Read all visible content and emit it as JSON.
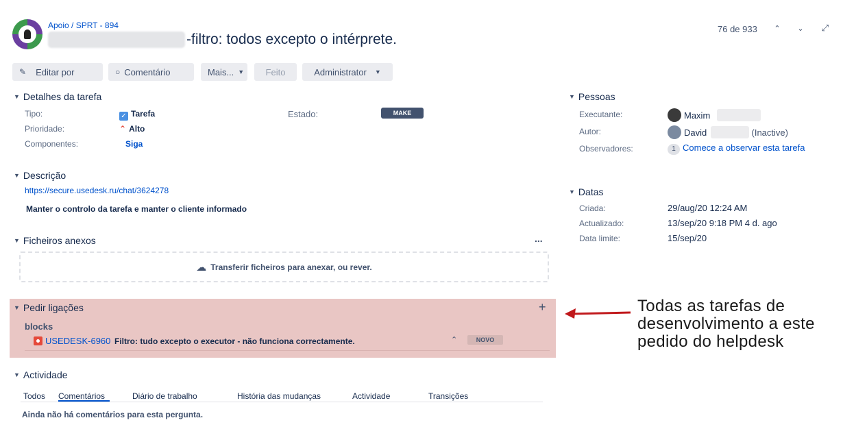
{
  "header": {
    "breadcrumb": "Apoio / SPRT - 894",
    "title": "-filtro: todos excepto o intérprete.",
    "counter": "76 de 933"
  },
  "toolbar": {
    "edit_label": "Editar por",
    "comment_label": "Comentário",
    "more_label": "Mais...",
    "done_label": "Feito",
    "admin_label": "Administrator"
  },
  "details": {
    "heading": "Detalhes da tarefa",
    "type_label": "Tipo:",
    "type_value": "Tarefa",
    "priority_label": "Prioridade:",
    "priority_value": "Alto",
    "components_label": "Componentes:",
    "components_value": "Siga",
    "status_label": "Estado:",
    "status_value": "MAKE"
  },
  "description": {
    "heading": "Descrição",
    "link": "https://secure.usedesk.ru/chat/3624278",
    "text": "Manter o controlo da tarefa e manter o cliente informado"
  },
  "attachments": {
    "heading": "Ficheiros anexos",
    "more": "...",
    "drop_text": "Transferir ficheiros para anexar, ou rever."
  },
  "links": {
    "heading": "Pedir ligações",
    "add": "+",
    "relation": "blocks",
    "issue_key": "USEDESK-6960",
    "issue_summary": "Filtro: tudo excepto o executor - não funciona correctamente.",
    "issue_status": "NOVO"
  },
  "activity": {
    "heading": "Actividade",
    "tabs": [
      "Todos",
      "Comentários",
      "Diário de trabalho",
      "História das mudanças",
      "Actividade",
      "Transições"
    ],
    "empty_text": "Ainda não há comentários para esta pergunta."
  },
  "people": {
    "heading": "Pessoas",
    "assignee_label": "Executante:",
    "assignee_value": "Maxim",
    "reporter_label": "Autor:",
    "reporter_value": "David",
    "reporter_suffix": "(Inactive)",
    "watchers_label": "Observadores:",
    "watchers_count": "1",
    "watchers_action": "Comece a observar esta tarefa"
  },
  "dates": {
    "heading": "Datas",
    "created_label": "Criada:",
    "created_value": "29/aug/20 12:24 AM",
    "updated_label": "Actualizado:",
    "updated_value": "13/sep/20 9:18 PM 4 d. ago",
    "due_label": "Data limite:",
    "due_value": "15/sep/20"
  },
  "annotation": {
    "text": "Todas as tarefas de desenvolvimento a este pedido do helpdesk",
    "color": "#c0181b"
  }
}
